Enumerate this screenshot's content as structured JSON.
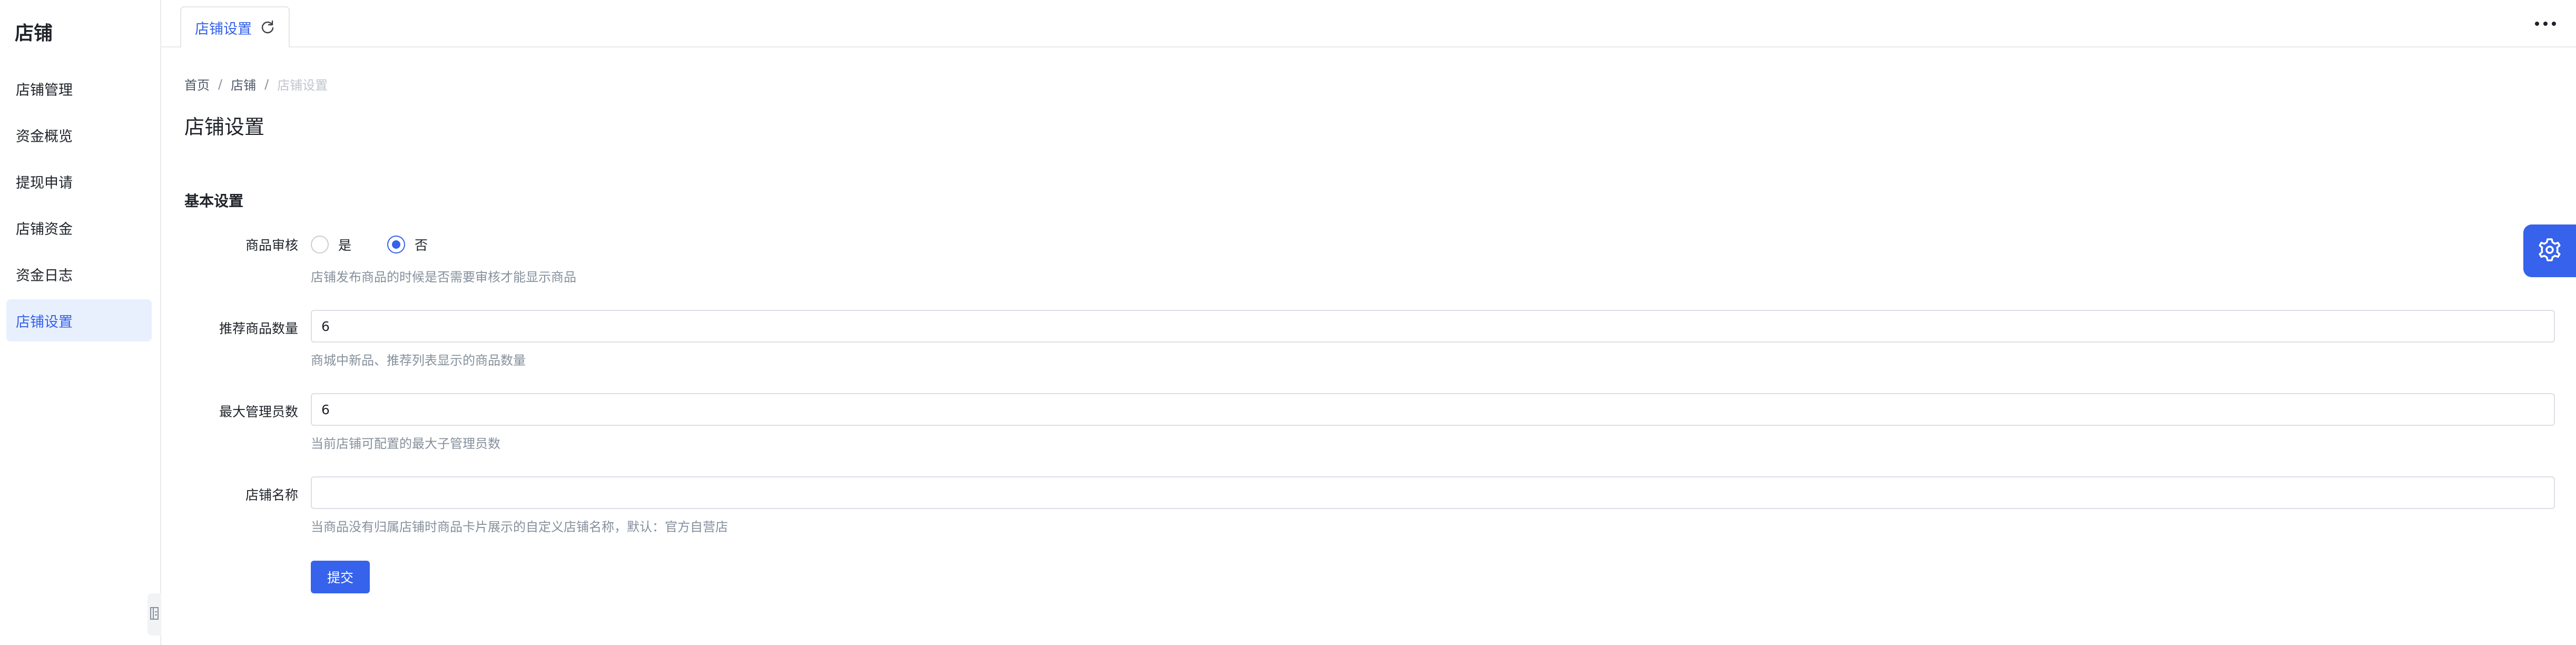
{
  "sidebar": {
    "title": "店铺",
    "items": [
      {
        "label": "店铺管理"
      },
      {
        "label": "资金概览"
      },
      {
        "label": "提现申请"
      },
      {
        "label": "店铺资金"
      },
      {
        "label": "资金日志"
      },
      {
        "label": "店铺设置",
        "active": true
      }
    ]
  },
  "tabs": [
    {
      "label": "店铺设置"
    }
  ],
  "breadcrumb": {
    "home": "首页",
    "section": "店铺",
    "current": "店铺设置"
  },
  "page": {
    "title": "店铺设置",
    "section_title": "基本设置"
  },
  "form": {
    "product_review": {
      "label": "商品审核",
      "options": [
        {
          "label": "是",
          "checked": false
        },
        {
          "label": "否",
          "checked": true
        }
      ],
      "help": "店铺发布商品的时候是否需要审核才能显示商品"
    },
    "recommend_count": {
      "label": "推荐商品数量",
      "value": "6",
      "help": "商城中新品、推荐列表显示的商品数量"
    },
    "max_admins": {
      "label": "最大管理员数",
      "value": "6",
      "help": "当前店铺可配置的最大子管理员数"
    },
    "shop_name": {
      "label": "店铺名称",
      "value": "",
      "help": "当商品没有归属店铺时商品卡片展示的自定义店铺名称，默认：官方自营店"
    },
    "submit_label": "提交"
  },
  "colors": {
    "accent": "#3662ec",
    "active_bg": "#e8f0fe",
    "help_text": "#86909c"
  }
}
